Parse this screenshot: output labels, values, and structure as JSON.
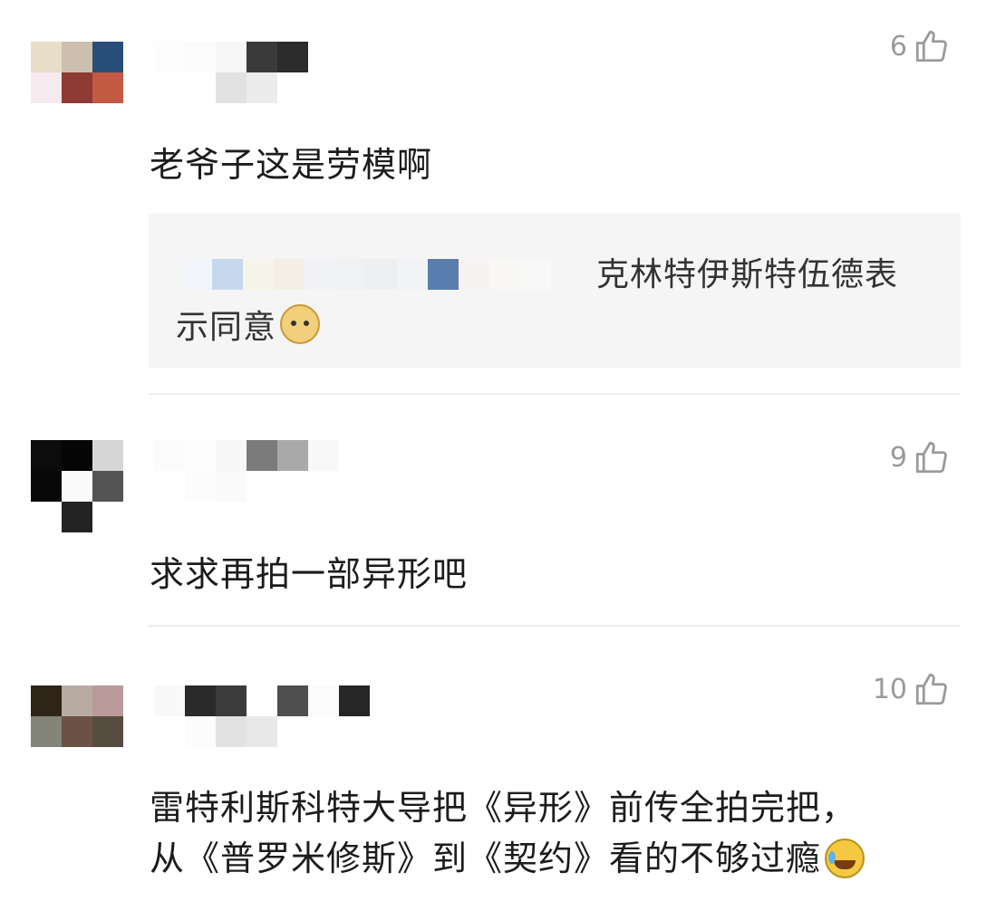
{
  "comments": [
    {
      "likes": "6",
      "text": "老爷子这是劳模啊",
      "reply": {
        "text_line1": "克林特伊斯特伍德表",
        "text_line2": "示同意",
        "emoji_icon": "doge-emoji"
      }
    },
    {
      "likes": "9",
      "text": "求求再拍一部异形吧"
    },
    {
      "likes": "10",
      "text_line1": "雷特利斯科特大导把《异形》前传全拍完把，",
      "text_line2": "从《普罗米修斯》到《契约》看的不够过瘾",
      "emoji_icon": "laugh-cry-emoji"
    }
  ],
  "colors": {
    "background": "#ffffff",
    "reply_background": "#f5f5f5",
    "like_count": "#9a9a9a",
    "comment_text": "#1c1c1c"
  }
}
